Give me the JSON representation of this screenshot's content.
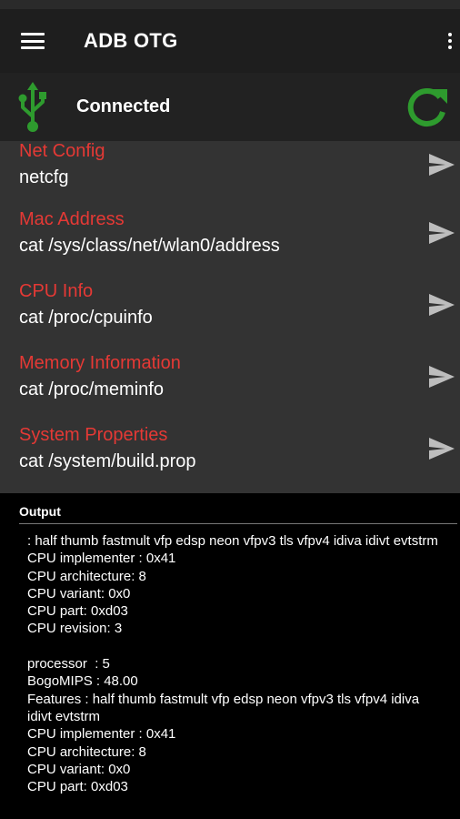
{
  "app": {
    "title": "ADB OTG"
  },
  "icons": {
    "menu": "menu-icon",
    "overflow": "more-vert-icon",
    "usb": "usb-icon",
    "refresh": "refresh-icon",
    "send": "send-icon"
  },
  "colors": {
    "accent_green": "#2e9b2e",
    "command_title_red": "#e53935",
    "toolbar_bg": "#1e1e1e",
    "list_bg": "#333333",
    "output_bg": "#000000"
  },
  "connection": {
    "status": "Connected"
  },
  "commands": [
    {
      "title": "Net Config",
      "command": "netcfg"
    },
    {
      "title": "Mac Address",
      "command": "cat /sys/class/net/wlan0/address"
    },
    {
      "title": "CPU Info",
      "command": "cat /proc/cpuinfo"
    },
    {
      "title": "Memory Information",
      "command": "cat /proc/meminfo"
    },
    {
      "title": "System Properties",
      "command": "cat /system/build.prop"
    }
  ],
  "output": {
    "label": "Output",
    "text": ": half thumb fastmult vfp edsp neon vfpv3 tls vfpv4 idiva idivt evtstrm\nCPU implementer : 0x41\nCPU architecture: 8\nCPU variant: 0x0\nCPU part: 0xd03\nCPU revision: 3\n\nprocessor  : 5\nBogoMIPS : 48.00\nFeatures : half thumb fastmult vfp edsp neon vfpv3 tls vfpv4 idiva idivt evtstrm\nCPU implementer : 0x41\nCPU architecture: 8\nCPU variant: 0x0\nCPU part: 0xd03"
  }
}
